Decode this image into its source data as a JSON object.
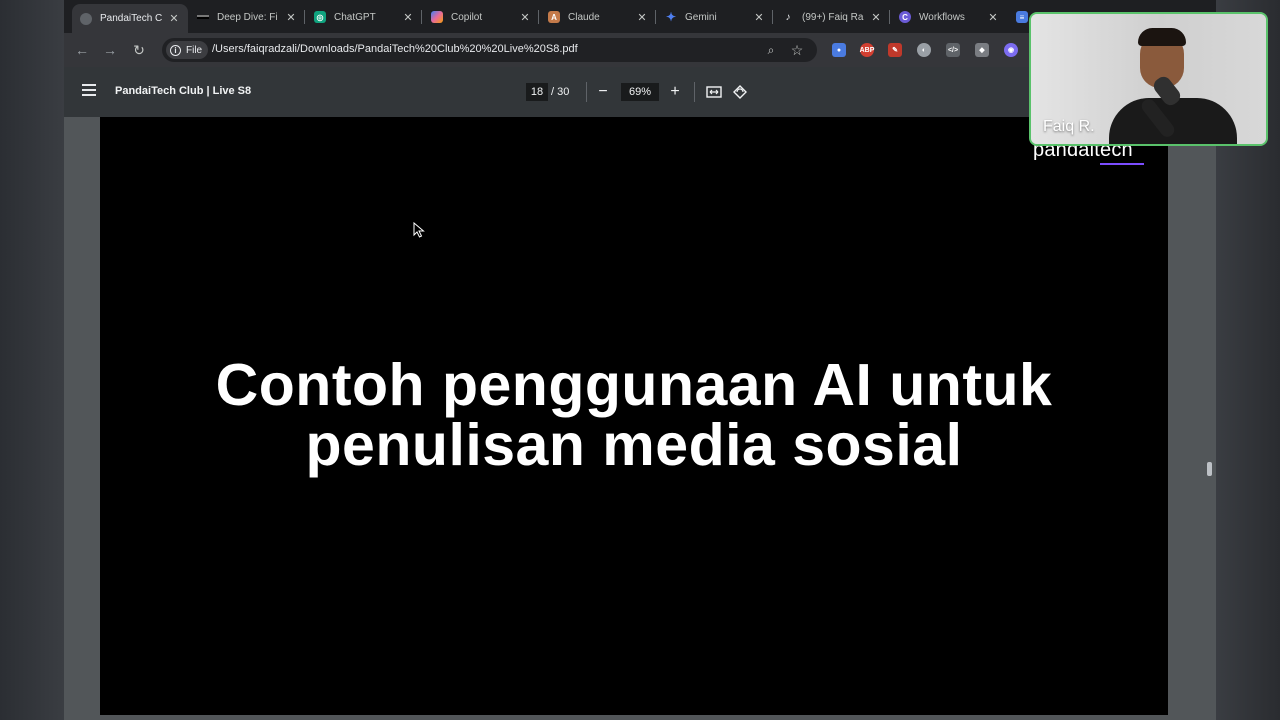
{
  "browser": {
    "tabs": [
      {
        "title": "PandaiTech C",
        "favicon": "globe-icon",
        "active": true,
        "color": "#8ab4f8"
      },
      {
        "title": "Deep Dive: Fi",
        "favicon": "deepdive-icon",
        "active": false,
        "color": "#000000"
      },
      {
        "title": "ChatGPT",
        "favicon": "chatgpt-icon",
        "active": false,
        "color": "#10a37f"
      },
      {
        "title": "Copilot",
        "favicon": "copilot-icon",
        "active": false,
        "color": "#e86a9a"
      },
      {
        "title": "Claude",
        "favicon": "claude-icon",
        "active": false,
        "color": "#c47a4a"
      },
      {
        "title": "Gemini",
        "favicon": "gemini-icon",
        "active": false,
        "color": "#4f7ff0"
      },
      {
        "title": "(99+) Faiq Ra",
        "favicon": "tiktok-icon",
        "active": false,
        "color": "#111111"
      },
      {
        "title": "Workflows",
        "favicon": "workflows-icon",
        "active": false,
        "color": "#6b5bd6"
      }
    ],
    "address": {
      "chip_label": "File",
      "url": "/Users/faiqradzali/Downloads/PandaiTech%20Club%20%20Live%20S8.pdf"
    }
  },
  "pdf": {
    "title": "PandaiTech Club | Live S8",
    "page_current": "18",
    "page_total": "/ 30",
    "zoom": "69%"
  },
  "slide": {
    "title_line1": "Contoh penggunaan AI untuk",
    "title_line2": "penulisan media sosial",
    "brand": "pandaitech",
    "brand_accent": "#7c4dff"
  },
  "webcam": {
    "name": "Faiq R.",
    "border_color": "#5ac26b"
  }
}
